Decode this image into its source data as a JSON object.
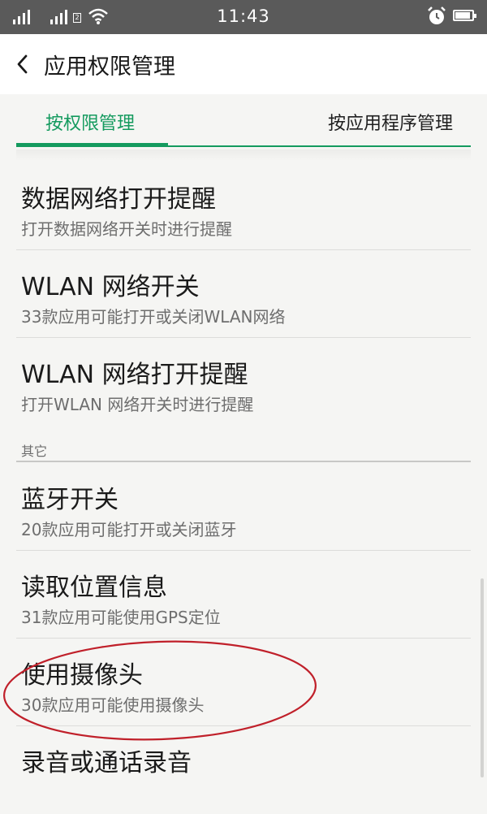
{
  "status_bar": {
    "time": "11:43",
    "sim2_label": "2",
    "icons": [
      "signal-icon",
      "signal-icon-sim2",
      "wifi-icon",
      "alarm-icon",
      "battery-icon"
    ],
    "battery_level": 0.9
  },
  "header": {
    "back_icon": "chevron-left-icon",
    "title": "应用权限管理"
  },
  "tabs": [
    {
      "label": "按权限管理",
      "active": true
    },
    {
      "label": "按应用程序管理",
      "active": false
    }
  ],
  "colors": {
    "accent": "#149a5e",
    "status_bar": "#5a5a5a",
    "annotation": "#c0202a"
  },
  "items_top": [
    {
      "title": "数据网络打开提醒",
      "subtitle": "打开数据网络开关时进行提醒"
    },
    {
      "title": "WLAN 网络开关",
      "subtitle": "33款应用可能打开或关闭WLAN网络"
    },
    {
      "title": "WLAN 网络打开提醒",
      "subtitle": "打开WLAN 网络开关时进行提醒"
    }
  ],
  "section_other": "其它",
  "items_other": [
    {
      "title": "蓝牙开关",
      "subtitle": "20款应用可能打开或关闭蓝牙"
    },
    {
      "title": "读取位置信息",
      "subtitle": "31款应用可能使用GPS定位"
    },
    {
      "title": "使用摄像头",
      "subtitle": "30款应用可能使用摄像头"
    },
    {
      "title": "录音或通话录音",
      "subtitle": ""
    }
  ]
}
